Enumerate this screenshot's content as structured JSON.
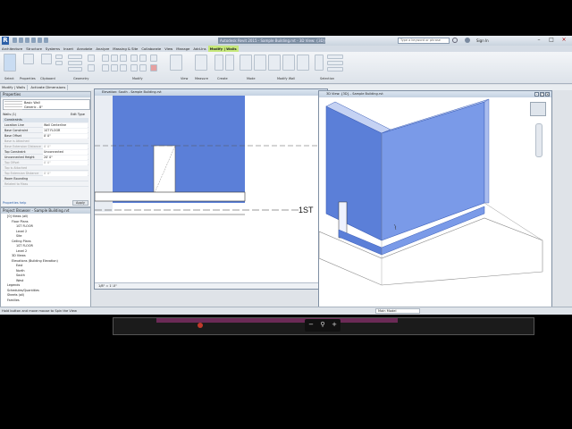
{
  "app": {
    "title": "Autodesk Revit 2015 - Sample Building.rvt - 3D View: {3D}",
    "search_placeholder": "Type a keyword or phrase",
    "sign_in": "Sign In"
  },
  "tabs": [
    "Architecture",
    "Structure",
    "Systems",
    "Insert",
    "Annotate",
    "Analyze",
    "Massing & Site",
    "Collaborate",
    "View",
    "Manage",
    "Add-Ins",
    "Modify | Walls"
  ],
  "active_tab": "Modify | Walls",
  "ribbon_groups": [
    "Select",
    "Properties",
    "Clipboard",
    "Geometry",
    "Modify",
    "View",
    "Measure",
    "Create",
    "Mode",
    "Modify Wall",
    "Selection"
  ],
  "ribbon_buttons": {
    "modify": "Modify",
    "paste": "Paste",
    "cope": "Cope",
    "cut": "Cut",
    "join": "Join",
    "edit_profile": "Edit Profile",
    "reset_profile": "Reset Profile",
    "wall_opening": "Wall Opening",
    "attach": "Attach Top/Base",
    "detach": "Detach Top/Base",
    "filter": "Filter",
    "save": "Save",
    "load": "Load",
    "edit": "Edit"
  },
  "modify_bar": [
    "Modify | Walls",
    "Activate Dimensions"
  ],
  "properties": {
    "title": "Properties",
    "type_family": "Basic Wall",
    "type_name": "Generic - 8\"",
    "type_selector": "Walls (1)",
    "edit_type": "Edit Type",
    "section": "Constraints",
    "rows": [
      {
        "label": "Location Line",
        "value": "Wall Centerline",
        "grey": false
      },
      {
        "label": "Base Constraint",
        "value": "1ST FLOOR",
        "grey": false
      },
      {
        "label": "Base Offset",
        "value": "0' 0\"",
        "grey": false
      },
      {
        "label": "Base is Attached",
        "value": "",
        "grey": true
      },
      {
        "label": "Base Extension Distance",
        "value": "0' 0\"",
        "grey": true
      },
      {
        "label": "Top Constraint",
        "value": "Unconnected",
        "grey": false
      },
      {
        "label": "Unconnected Height",
        "value": "20' 0\"",
        "grey": false
      },
      {
        "label": "Top Offset",
        "value": "0' 0\"",
        "grey": true
      },
      {
        "label": "Top is Attached",
        "value": "",
        "grey": true
      },
      {
        "label": "Top Extension Distance",
        "value": "0' 0\"",
        "grey": true
      },
      {
        "label": "Room Bounding",
        "value": "",
        "grey": false
      },
      {
        "label": "Related to Mass",
        "value": "",
        "grey": true
      }
    ],
    "help": "Properties help",
    "apply": "Apply"
  },
  "browser": {
    "title": "Project Browser - Sample Building.rvt",
    "items": [
      {
        "text": "[0] Views (all)",
        "indent": 1
      },
      {
        "text": "Floor Plans",
        "indent": 2
      },
      {
        "text": "1ST FLOOR",
        "indent": 3
      },
      {
        "text": "Level 2",
        "indent": 3
      },
      {
        "text": "Site",
        "indent": 3
      },
      {
        "text": "Ceiling Plans",
        "indent": 2
      },
      {
        "text": "1ST FLOOR",
        "indent": 3
      },
      {
        "text": "Level 2",
        "indent": 3
      },
      {
        "text": "3D Views",
        "indent": 2
      },
      {
        "text": "Elevations (Building Elevation)",
        "indent": 2
      },
      {
        "text": "East",
        "indent": 3
      },
      {
        "text": "North",
        "indent": 3
      },
      {
        "text": "South",
        "indent": 3
      },
      {
        "text": "West",
        "indent": 3
      },
      {
        "text": "Legends",
        "indent": 1
      },
      {
        "text": "Schedules/Quantities",
        "indent": 1
      },
      {
        "text": "Sheets (all)",
        "indent": 1
      },
      {
        "text": "Families",
        "indent": 1
      }
    ]
  },
  "south_view": {
    "title": "Elevation: South - Sample Building.rvt",
    "level_label": "1ST",
    "scale": "1/8\" = 1'-0\""
  },
  "view3d": {
    "title": "3D View: {3D} - Sample Building.rvt",
    "scale": "1/8\" = 1'-0\""
  },
  "status": {
    "text": "Hold button and move mouse to Spin the View",
    "model": "Main Model"
  },
  "colors": {
    "wall_blue": "#5b7fd8",
    "selection_blue": "#6d8ee8",
    "active_tab": "#c7e87c"
  }
}
